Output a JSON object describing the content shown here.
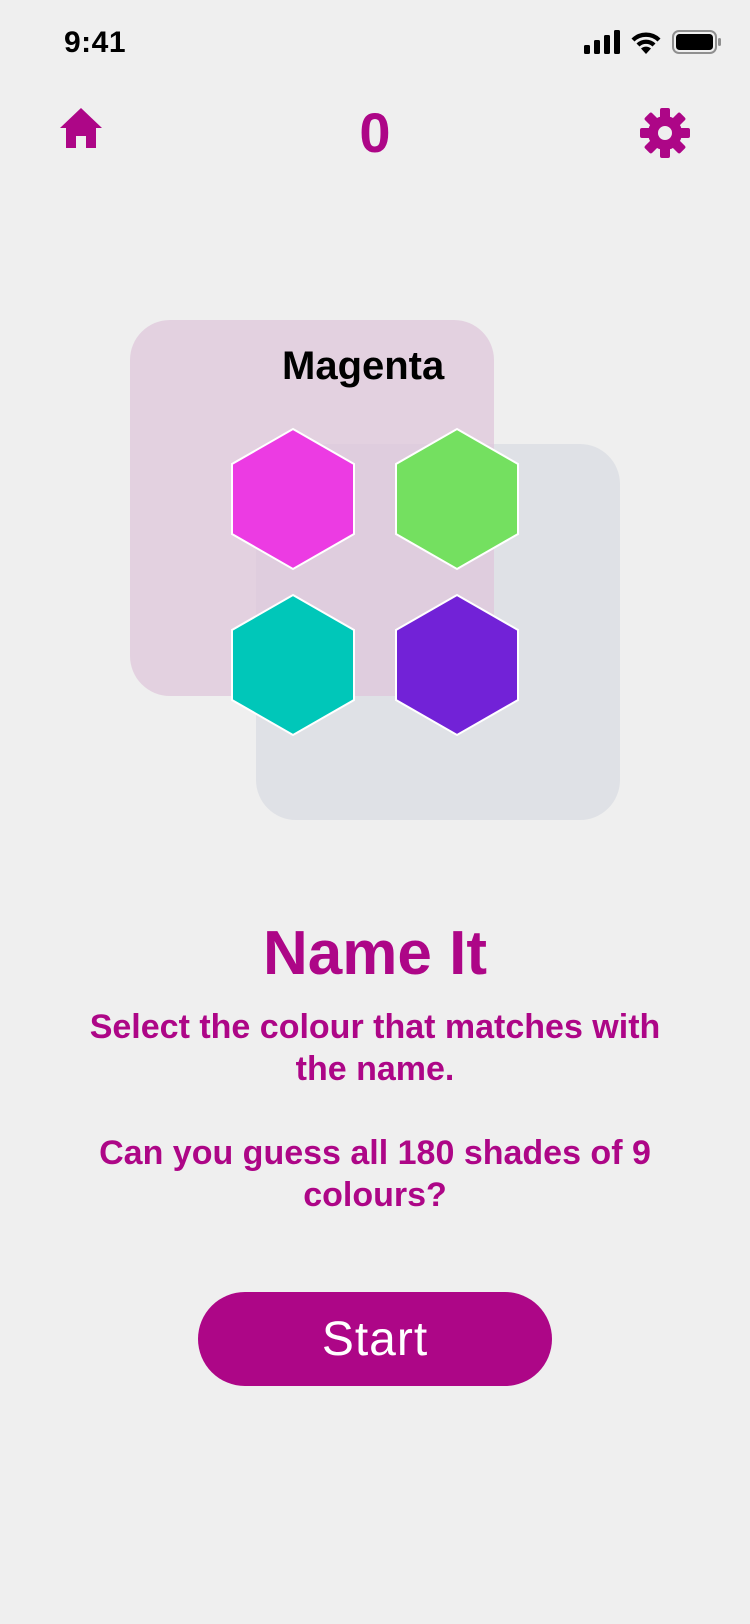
{
  "status_bar": {
    "time": "9:41",
    "icons": [
      "signal-icon",
      "wifi-icon",
      "battery-icon"
    ]
  },
  "header": {
    "home_icon": "home-icon",
    "score": "0",
    "settings_icon": "gear-icon",
    "accent_color": "#ad0687"
  },
  "preview": {
    "color_name": "Magenta",
    "swatches": [
      {
        "name": "magenta",
        "color": "#ec3be3"
      },
      {
        "name": "green",
        "color": "#74e060"
      },
      {
        "name": "teal",
        "color": "#00c7b9"
      },
      {
        "name": "purple",
        "color": "#7222d7"
      }
    ]
  },
  "main": {
    "title": "Name It",
    "description_1": "Select the colour that matches with the name.",
    "description_2": "Can you guess all 180 shades of 9 colours?",
    "start_label": "Start"
  }
}
